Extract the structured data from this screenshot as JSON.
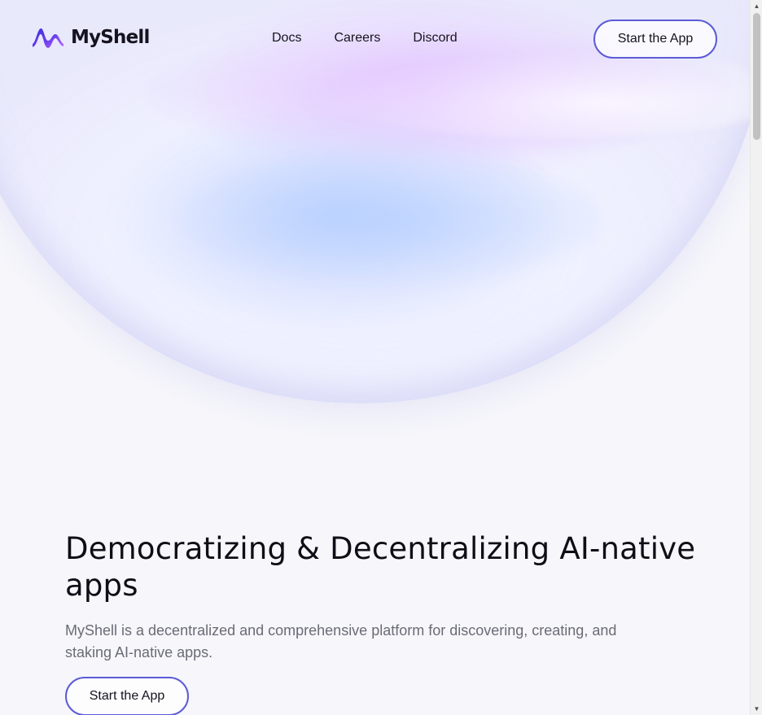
{
  "brand": {
    "name": "MyShell",
    "logo_icon": "myshell-wave-logo",
    "accent": "#5b5bd6"
  },
  "nav": {
    "items": [
      {
        "label": "Docs"
      },
      {
        "label": "Careers"
      },
      {
        "label": "Discord"
      }
    ]
  },
  "header": {
    "cta_label": "Start the App"
  },
  "hero": {
    "title": "Democratizing & Decentralizing AI-native apps",
    "subtitle": "MyShell is a decentralized and comprehensive platform for discovering, creating, and staking AI-native apps.",
    "cta_label": "Start the App"
  },
  "scrollbar": {
    "up_icon": "triangle-up",
    "down_icon": "triangle-down"
  }
}
